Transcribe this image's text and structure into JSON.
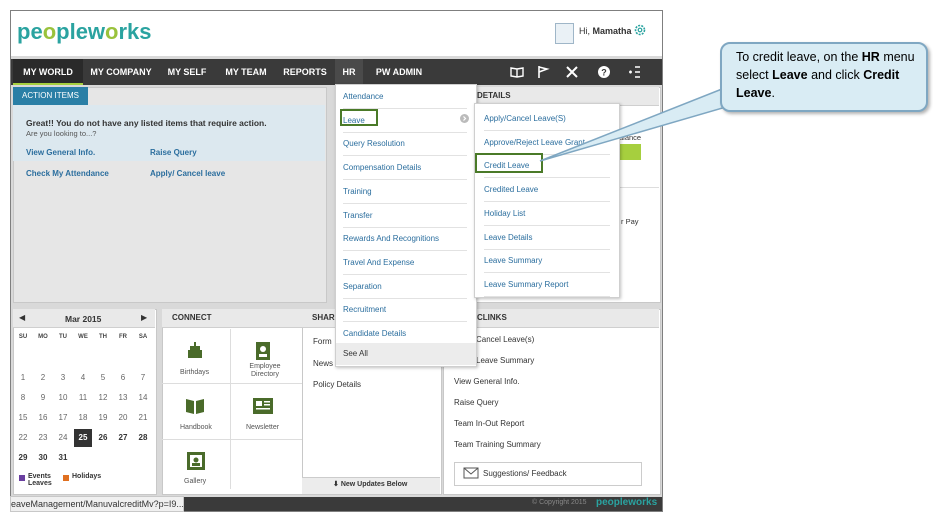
{
  "header": {
    "logo": "peopleworks",
    "greeting": "Hi,",
    "user_name": "Mamatha"
  },
  "nav": {
    "items": [
      "MY WORLD",
      "MY COMPANY",
      "MY SELF",
      "MY TEAM",
      "REPORTS",
      "HR",
      "PW ADMIN"
    ],
    "icons": [
      "book-icon",
      "flag-icon",
      "tools-icon",
      "help-icon",
      "menu-icon"
    ]
  },
  "action_items": {
    "tab": "ACTION ITEMS",
    "message": "Great!! You do not have any listed items that require action.",
    "sub": "Are you looking to...?",
    "links": [
      "View General Info.",
      "Raise Query",
      "Check My Attendance",
      "Apply/ Cancel leave"
    ]
  },
  "details_panel": {
    "title": "DETAILS",
    "text1": "alance",
    "text2": "r Pay"
  },
  "hr_menu": {
    "items": [
      "Attendance",
      "Leave",
      "Query Resolution",
      "Compensation Details",
      "Training",
      "Transfer",
      "Rewards And Recognitions",
      "Travel And Expense",
      "Separation",
      "Recruitment",
      "Candidate Details"
    ],
    "see_all": "See All"
  },
  "leave_submenu": {
    "items": [
      "Apply/Cancel Leave(S)",
      "Approve/Reject Leave Grant",
      "Credit Leave",
      "Credited Leave",
      "Holiday List",
      "Leave Details",
      "Leave Summary",
      "Leave Summary Report"
    ]
  },
  "calendar": {
    "month": "Mar 2015",
    "weekdays": [
      "SU",
      "MO",
      "TU",
      "WE",
      "TH",
      "FR",
      "SA"
    ],
    "weeks": [
      [
        "1",
        "2",
        "3",
        "4",
        "5",
        "6",
        "7"
      ],
      [
        "8",
        "9",
        "10",
        "11",
        "12",
        "13",
        "14"
      ],
      [
        "15",
        "16",
        "17",
        "18",
        "19",
        "20",
        "21"
      ],
      [
        "22",
        "23",
        "24",
        "25",
        "26",
        "27",
        "28"
      ],
      [
        "29",
        "30",
        "31",
        "",
        "",
        "",
        ""
      ]
    ],
    "today": "25",
    "legend": [
      "Events Leaves",
      "Holidays"
    ]
  },
  "connect": {
    "title": "CONNECT",
    "items": [
      "Birthdays",
      "Employee Directory",
      "Handbook",
      "Newsletter",
      "Gallery"
    ]
  },
  "share": {
    "title": "SHAR",
    "items": [
      "Form",
      "News",
      "Policy Details"
    ],
    "updates": "New Updates Below"
  },
  "quick_links": {
    "title": "CLINKS",
    "items": [
      "Cancel Leave(s)",
      "Leave Summary",
      "View General Info.",
      "Raise Query",
      "Team In-Out Report",
      "Team Training Summary"
    ],
    "feedback": "Suggestions/ Feedback"
  },
  "footer": {
    "copyright": "© Copyright 2015",
    "logo": "peopleworks"
  },
  "status_bar": "eaveManagement/ManuvalcreditMv?p=I9...",
  "callout": {
    "prefix": "To credit leave, on the ",
    "menu": "HR",
    "mid": " menu select ",
    "item": "Leave",
    "mid2": " and click ",
    "action": "Credit Leave",
    "suffix": "."
  },
  "colors": {
    "accent": "#a6cf3e",
    "link": "#2b6e9e",
    "nav": "#3a3a3a",
    "tab": "#2a7fa6"
  }
}
